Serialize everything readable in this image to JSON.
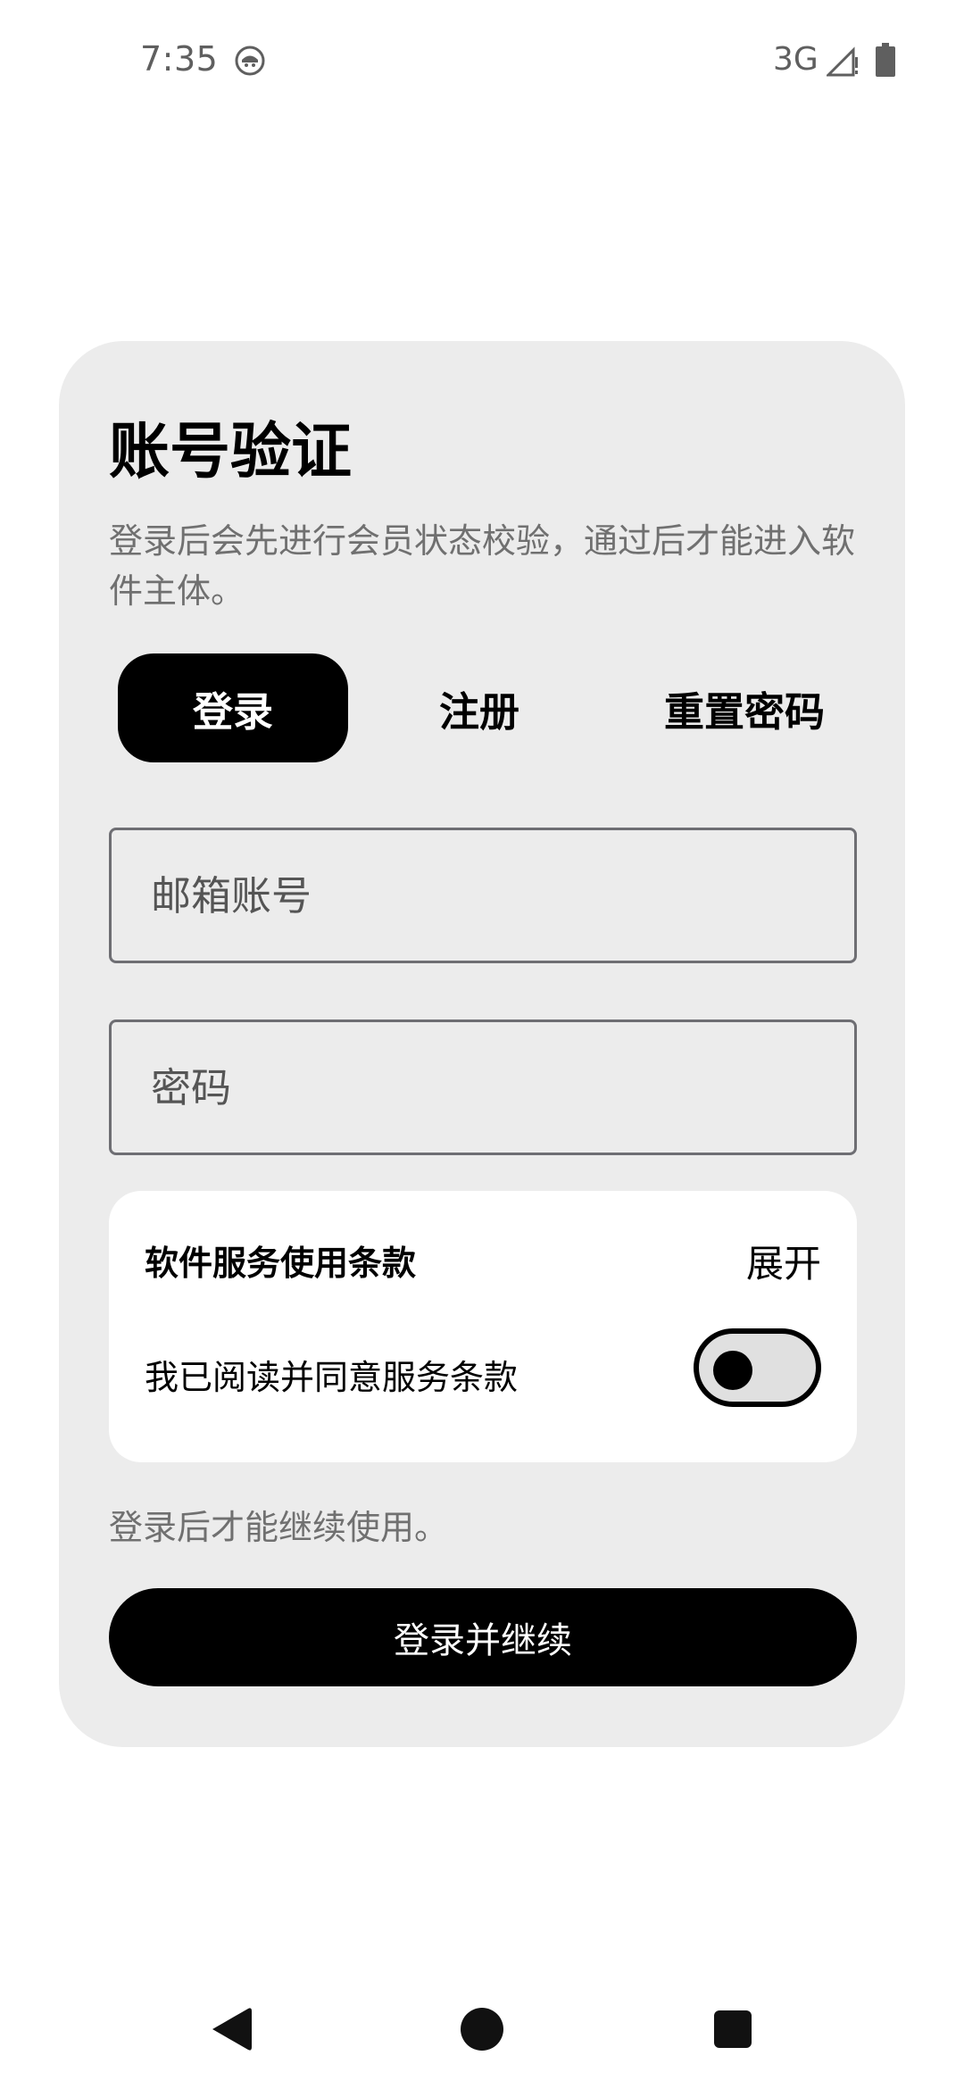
{
  "status_bar": {
    "time": "7:35",
    "network": "3G",
    "icons": [
      "app-notification-icon",
      "signal-icon",
      "battery-icon"
    ]
  },
  "card": {
    "title": "账号验证",
    "subtitle": "登录后会先进行会员状态校验，通过后才能进入软件主体。"
  },
  "tabs": [
    {
      "label": "登录",
      "active": true
    },
    {
      "label": "注册",
      "active": false
    },
    {
      "label": "重置密码",
      "active": false
    }
  ],
  "form": {
    "email_placeholder": "邮箱账号",
    "email_value": "",
    "password_placeholder": "密码",
    "password_value": ""
  },
  "terms": {
    "title": "软件服务使用条款",
    "expand_label": "展开",
    "agree_label": "我已阅读并同意服务条款",
    "agreed": false
  },
  "hint": "登录后才能继续使用。",
  "primary_button": "登录并继续",
  "nav": {
    "icons": [
      "back-icon",
      "home-icon",
      "recents-icon"
    ]
  },
  "colors": {
    "card_bg": "#ececec",
    "accent": "#000000",
    "muted_text": "#707070"
  }
}
